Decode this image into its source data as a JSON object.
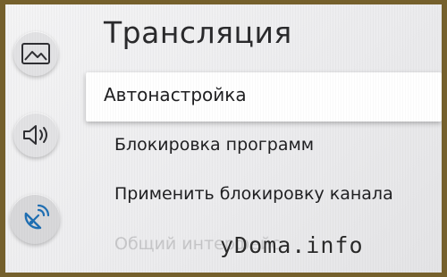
{
  "header": {
    "title": "Трансляция"
  },
  "sidebar": {
    "icons": [
      {
        "name": "picture-icon"
      },
      {
        "name": "sound-icon"
      },
      {
        "name": "broadcast-icon",
        "active": true
      }
    ]
  },
  "menu": {
    "items": [
      {
        "label": "Автонастройка",
        "selected": true
      },
      {
        "label": "Блокировка программ"
      },
      {
        "label": "Применить блокировку канала"
      },
      {
        "label": "Общий интерфейс",
        "disabled": true
      }
    ]
  },
  "watermark": {
    "text": "yDoma.info"
  },
  "colors": {
    "frame": "#75602c",
    "background": "#efeff1",
    "selected_bg": "#ffffff",
    "text": "#1f1f21",
    "disabled_text": "#c6c6c8"
  }
}
